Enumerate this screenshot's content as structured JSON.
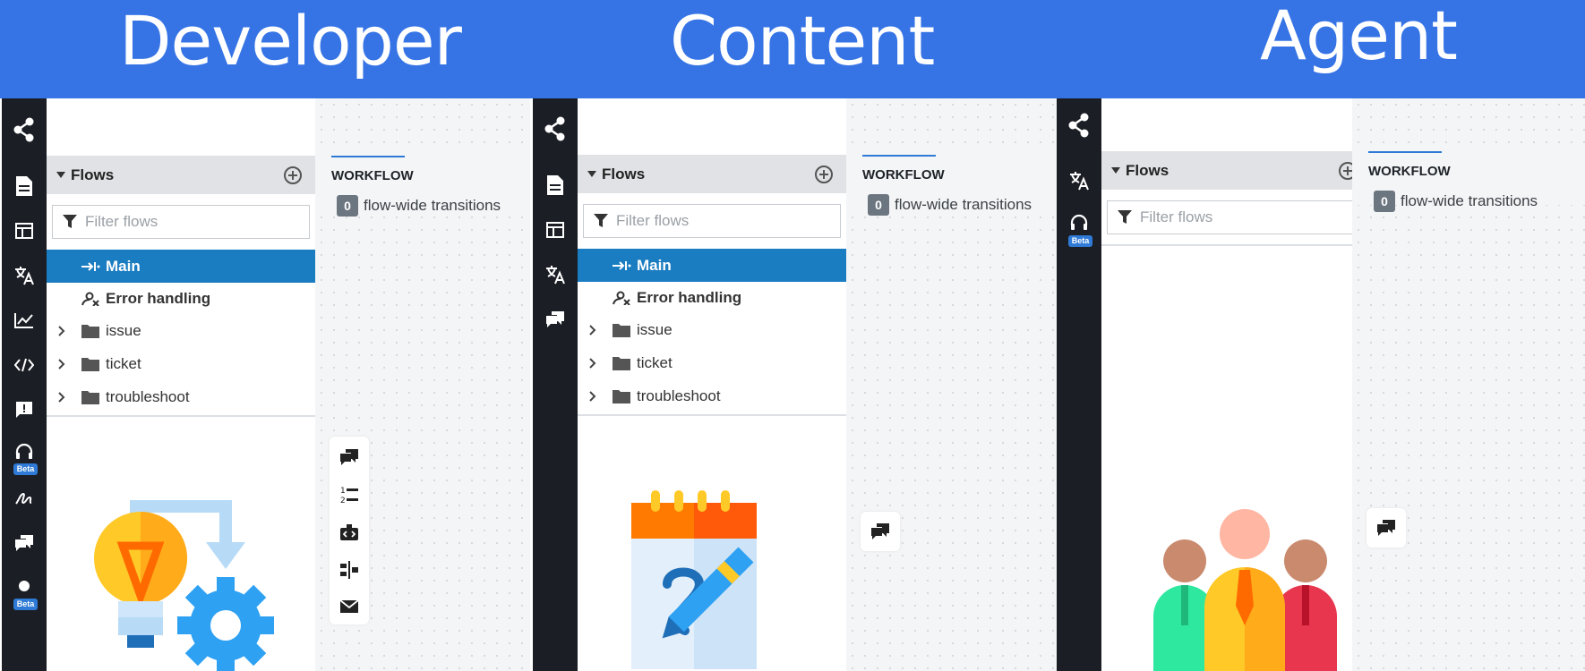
{
  "banner": {
    "color": "#3674e6",
    "roles": [
      "Developer",
      "Content",
      "Agent"
    ]
  },
  "panels": [
    {
      "role": "Developer",
      "rail_icons": [
        "share-icon",
        "document-icon",
        "table-icon",
        "translate-icon",
        "analytics-icon",
        "code-icon",
        "feedback-icon",
        "headset-icon",
        "signature-icon",
        "chat-bubbles-icon",
        "dot-icon"
      ],
      "rail_badges": [
        "Beta",
        "Beta"
      ],
      "flows": {
        "title": "Flows",
        "filter_placeholder": "Filter flows",
        "items": [
          {
            "label": "Main",
            "kind": "flow",
            "selected": true
          },
          {
            "label": "Error handling",
            "kind": "flow",
            "selected": false
          },
          {
            "label": "issue",
            "kind": "folder",
            "selected": false
          },
          {
            "label": "ticket",
            "kind": "folder",
            "selected": false
          },
          {
            "label": "troubleshoot",
            "kind": "folder",
            "selected": false
          }
        ]
      },
      "workflow": {
        "tab_label": "WORKFLOW",
        "transition_count": "0",
        "transition_label": "flow-wide transitions",
        "toolbox_icons": [
          "chat-bubbles-icon",
          "numbered-list-icon",
          "bot-icon",
          "split-icon",
          "envelope-icon"
        ]
      },
      "illustration": "lightbulb-gear-icon"
    },
    {
      "role": "Content",
      "rail_icons": [
        "share-icon",
        "document-icon",
        "table-icon",
        "translate-icon",
        "chat-bubbles-icon"
      ],
      "rail_badges": [],
      "flows": {
        "title": "Flows",
        "filter_placeholder": "Filter flows",
        "items": [
          {
            "label": "Main",
            "kind": "flow",
            "selected": true
          },
          {
            "label": "Error handling",
            "kind": "flow",
            "selected": false
          },
          {
            "label": "issue",
            "kind": "folder",
            "selected": false
          },
          {
            "label": "ticket",
            "kind": "folder",
            "selected": false
          },
          {
            "label": "troubleshoot",
            "kind": "folder",
            "selected": false
          }
        ]
      },
      "workflow": {
        "tab_label": "WORKFLOW",
        "transition_count": "0",
        "transition_label": "flow-wide transitions",
        "toolbox_icons": [
          "chat-bubbles-icon"
        ]
      },
      "illustration": "notepad-pen-icon"
    },
    {
      "role": "Agent",
      "rail_icons": [
        "share-icon",
        "translate-icon",
        "headset-icon"
      ],
      "rail_badges": [
        "Beta"
      ],
      "flows": {
        "title": "Flows",
        "filter_placeholder": "Filter flows",
        "items": []
      },
      "workflow": {
        "tab_label": "WORKFLOW",
        "transition_count": "0",
        "transition_label": "flow-wide transitions",
        "toolbox_icons": [
          "chat-bubbles-icon"
        ]
      },
      "illustration": "agents-group-icon"
    }
  ]
}
